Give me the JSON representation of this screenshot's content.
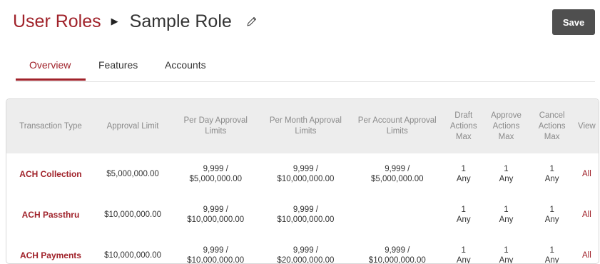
{
  "header": {
    "breadcrumb_root": "User Roles",
    "breadcrumb_separator": "▶",
    "breadcrumb_current": "Sample Role",
    "save_label": "Save"
  },
  "tabs": [
    {
      "label": "Overview",
      "active": true
    },
    {
      "label": "Features",
      "active": false
    },
    {
      "label": "Accounts",
      "active": false
    }
  ],
  "table": {
    "headers": {
      "transaction_type": "Transaction Type",
      "approval_limit": "Approval Limit",
      "per_day_1": "Per Day Approval",
      "per_day_2": "Limits",
      "per_month_1": "Per Month Approval",
      "per_month_2": "Limits",
      "per_account_1": "Per Account Approval",
      "per_account_2": "Limits",
      "draft_1": "Draft",
      "draft_2": "Actions",
      "draft_3": "Max",
      "approve_1": "Approve",
      "approve_2": "Actions",
      "approve_3": "Max",
      "cancel_1": "Cancel",
      "cancel_2": "Actions",
      "cancel_3": "Max",
      "view": "View"
    },
    "rows": [
      {
        "type": "ACH Collection",
        "approval_limit": "$5,000,000.00",
        "per_day_count": "9,999 /",
        "per_day_amount": "$5,000,000.00",
        "per_month_count": "9,999 /",
        "per_month_amount": "$10,000,000.00",
        "per_account_count": "9,999 /",
        "per_account_amount": "$5,000,000.00",
        "draft_num": "1",
        "draft_any": "Any",
        "approve_num": "1",
        "approve_any": "Any",
        "cancel_num": "1",
        "cancel_any": "Any",
        "view": "All"
      },
      {
        "type": "ACH Passthru",
        "approval_limit": "$10,000,000.00",
        "per_day_count": "9,999 /",
        "per_day_amount": "$10,000,000.00",
        "per_month_count": "9,999 /",
        "per_month_amount": "$10,000,000.00",
        "per_account_count": "",
        "per_account_amount": "",
        "draft_num": "1",
        "draft_any": "Any",
        "approve_num": "1",
        "approve_any": "Any",
        "cancel_num": "1",
        "cancel_any": "Any",
        "view": "All"
      },
      {
        "type": "ACH Payments",
        "approval_limit": "$10,000,000.00",
        "per_day_count": "9,999 /",
        "per_day_amount": "$10,000,000.00",
        "per_month_count": "9,999 /",
        "per_month_amount": "$20,000,000.00",
        "per_account_count": "9,999 /",
        "per_account_amount": "$10,000,000.00",
        "draft_num": "1",
        "draft_any": "Any",
        "approve_num": "1",
        "approve_any": "Any",
        "cancel_num": "1",
        "cancel_any": "Any",
        "view": "All"
      }
    ]
  },
  "icons": {
    "edit": "pencil-icon"
  },
  "colors": {
    "accent": "#a0222a",
    "button": "#4f4f4f",
    "header_bg": "#ededed"
  }
}
